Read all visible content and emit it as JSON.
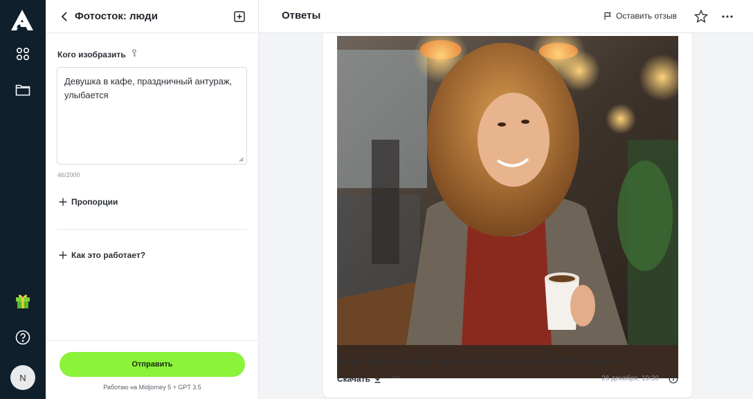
{
  "sidebar": {
    "avatar_initial": "N"
  },
  "panel": {
    "title": "Фотосток: люди",
    "prompt_label": "Кого изобразить",
    "prompt_value": "Девушка в кафе, праздничный антураж, улыбается",
    "counter": "46/2000",
    "proportions": "Пропорции",
    "how_it_works": "Как это работает?",
    "send_button": "Отправить",
    "powered_by": "Работаю на Midjorney 5 + GPT 3.5"
  },
  "main": {
    "title": "Ответы",
    "feedback": "Оставить отзыв",
    "answer": {
      "request": "Запрос: Девушка в кафе, праздничный антураж, улыбается Пропорции: 1:1",
      "download": "Скачать",
      "timestamp": "26 декабря, 19:30"
    }
  },
  "colors": {
    "rail": "#0f1f2c",
    "accent": "#8af33a"
  }
}
